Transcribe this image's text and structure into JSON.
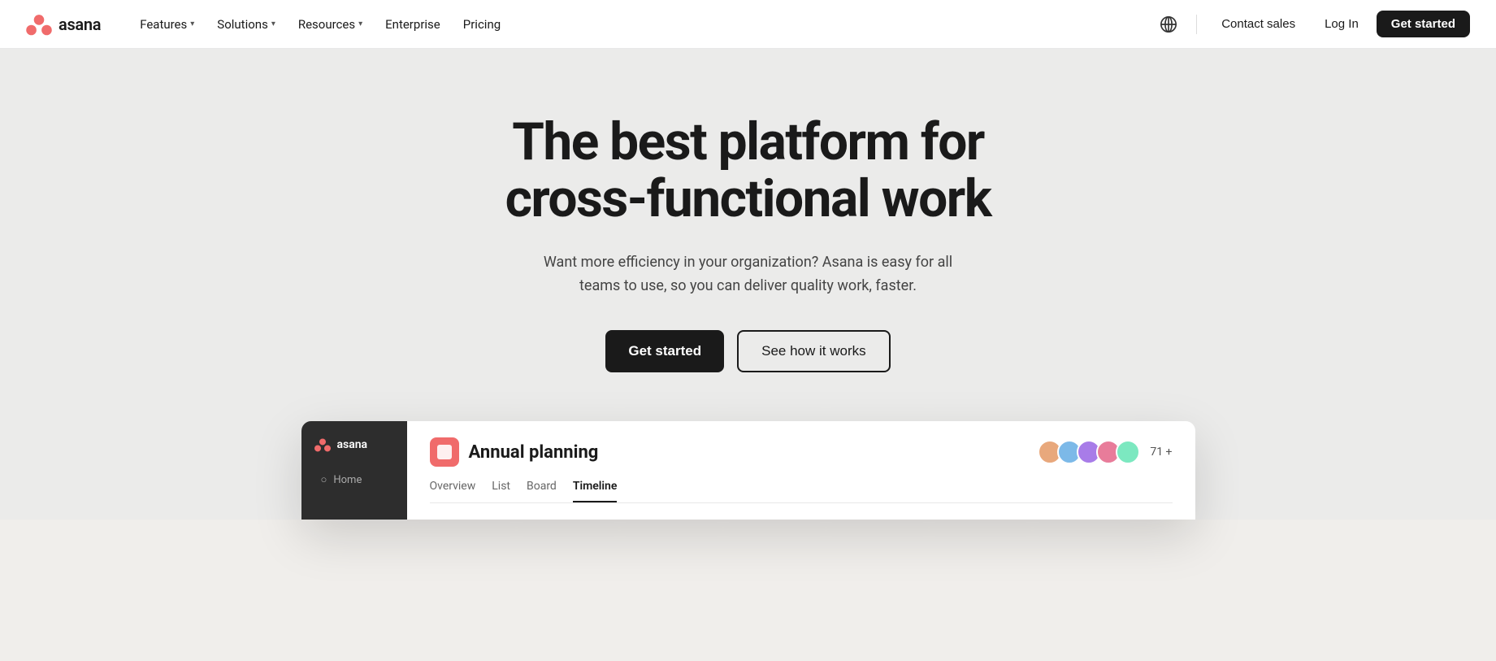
{
  "brand": {
    "name": "asana",
    "logo_alt": "Asana logo"
  },
  "navbar": {
    "features_label": "Features",
    "solutions_label": "Solutions",
    "resources_label": "Resources",
    "enterprise_label": "Enterprise",
    "pricing_label": "Pricing",
    "contact_sales_label": "Contact sales",
    "login_label": "Log In",
    "get_started_label": "Get started"
  },
  "hero": {
    "title_line1": "The best platform for",
    "title_line2": "cross-functional work",
    "subtitle": "Want more efficiency in your organization? Asana is easy for all teams to use, so you can deliver quality work, faster.",
    "cta_primary": "Get started",
    "cta_secondary": "See how it works"
  },
  "app_preview": {
    "sidebar": {
      "logo_text": "asana",
      "home_label": "Home"
    },
    "title": "Annual planning",
    "member_count": "71 +",
    "tabs": [
      {
        "label": "Overview",
        "active": false
      },
      {
        "label": "List",
        "active": false
      },
      {
        "label": "Board",
        "active": false
      },
      {
        "label": "Timeline",
        "active": true
      }
    ]
  },
  "icons": {
    "globe": "🌐",
    "home": "○",
    "chevron_down": "▾"
  }
}
